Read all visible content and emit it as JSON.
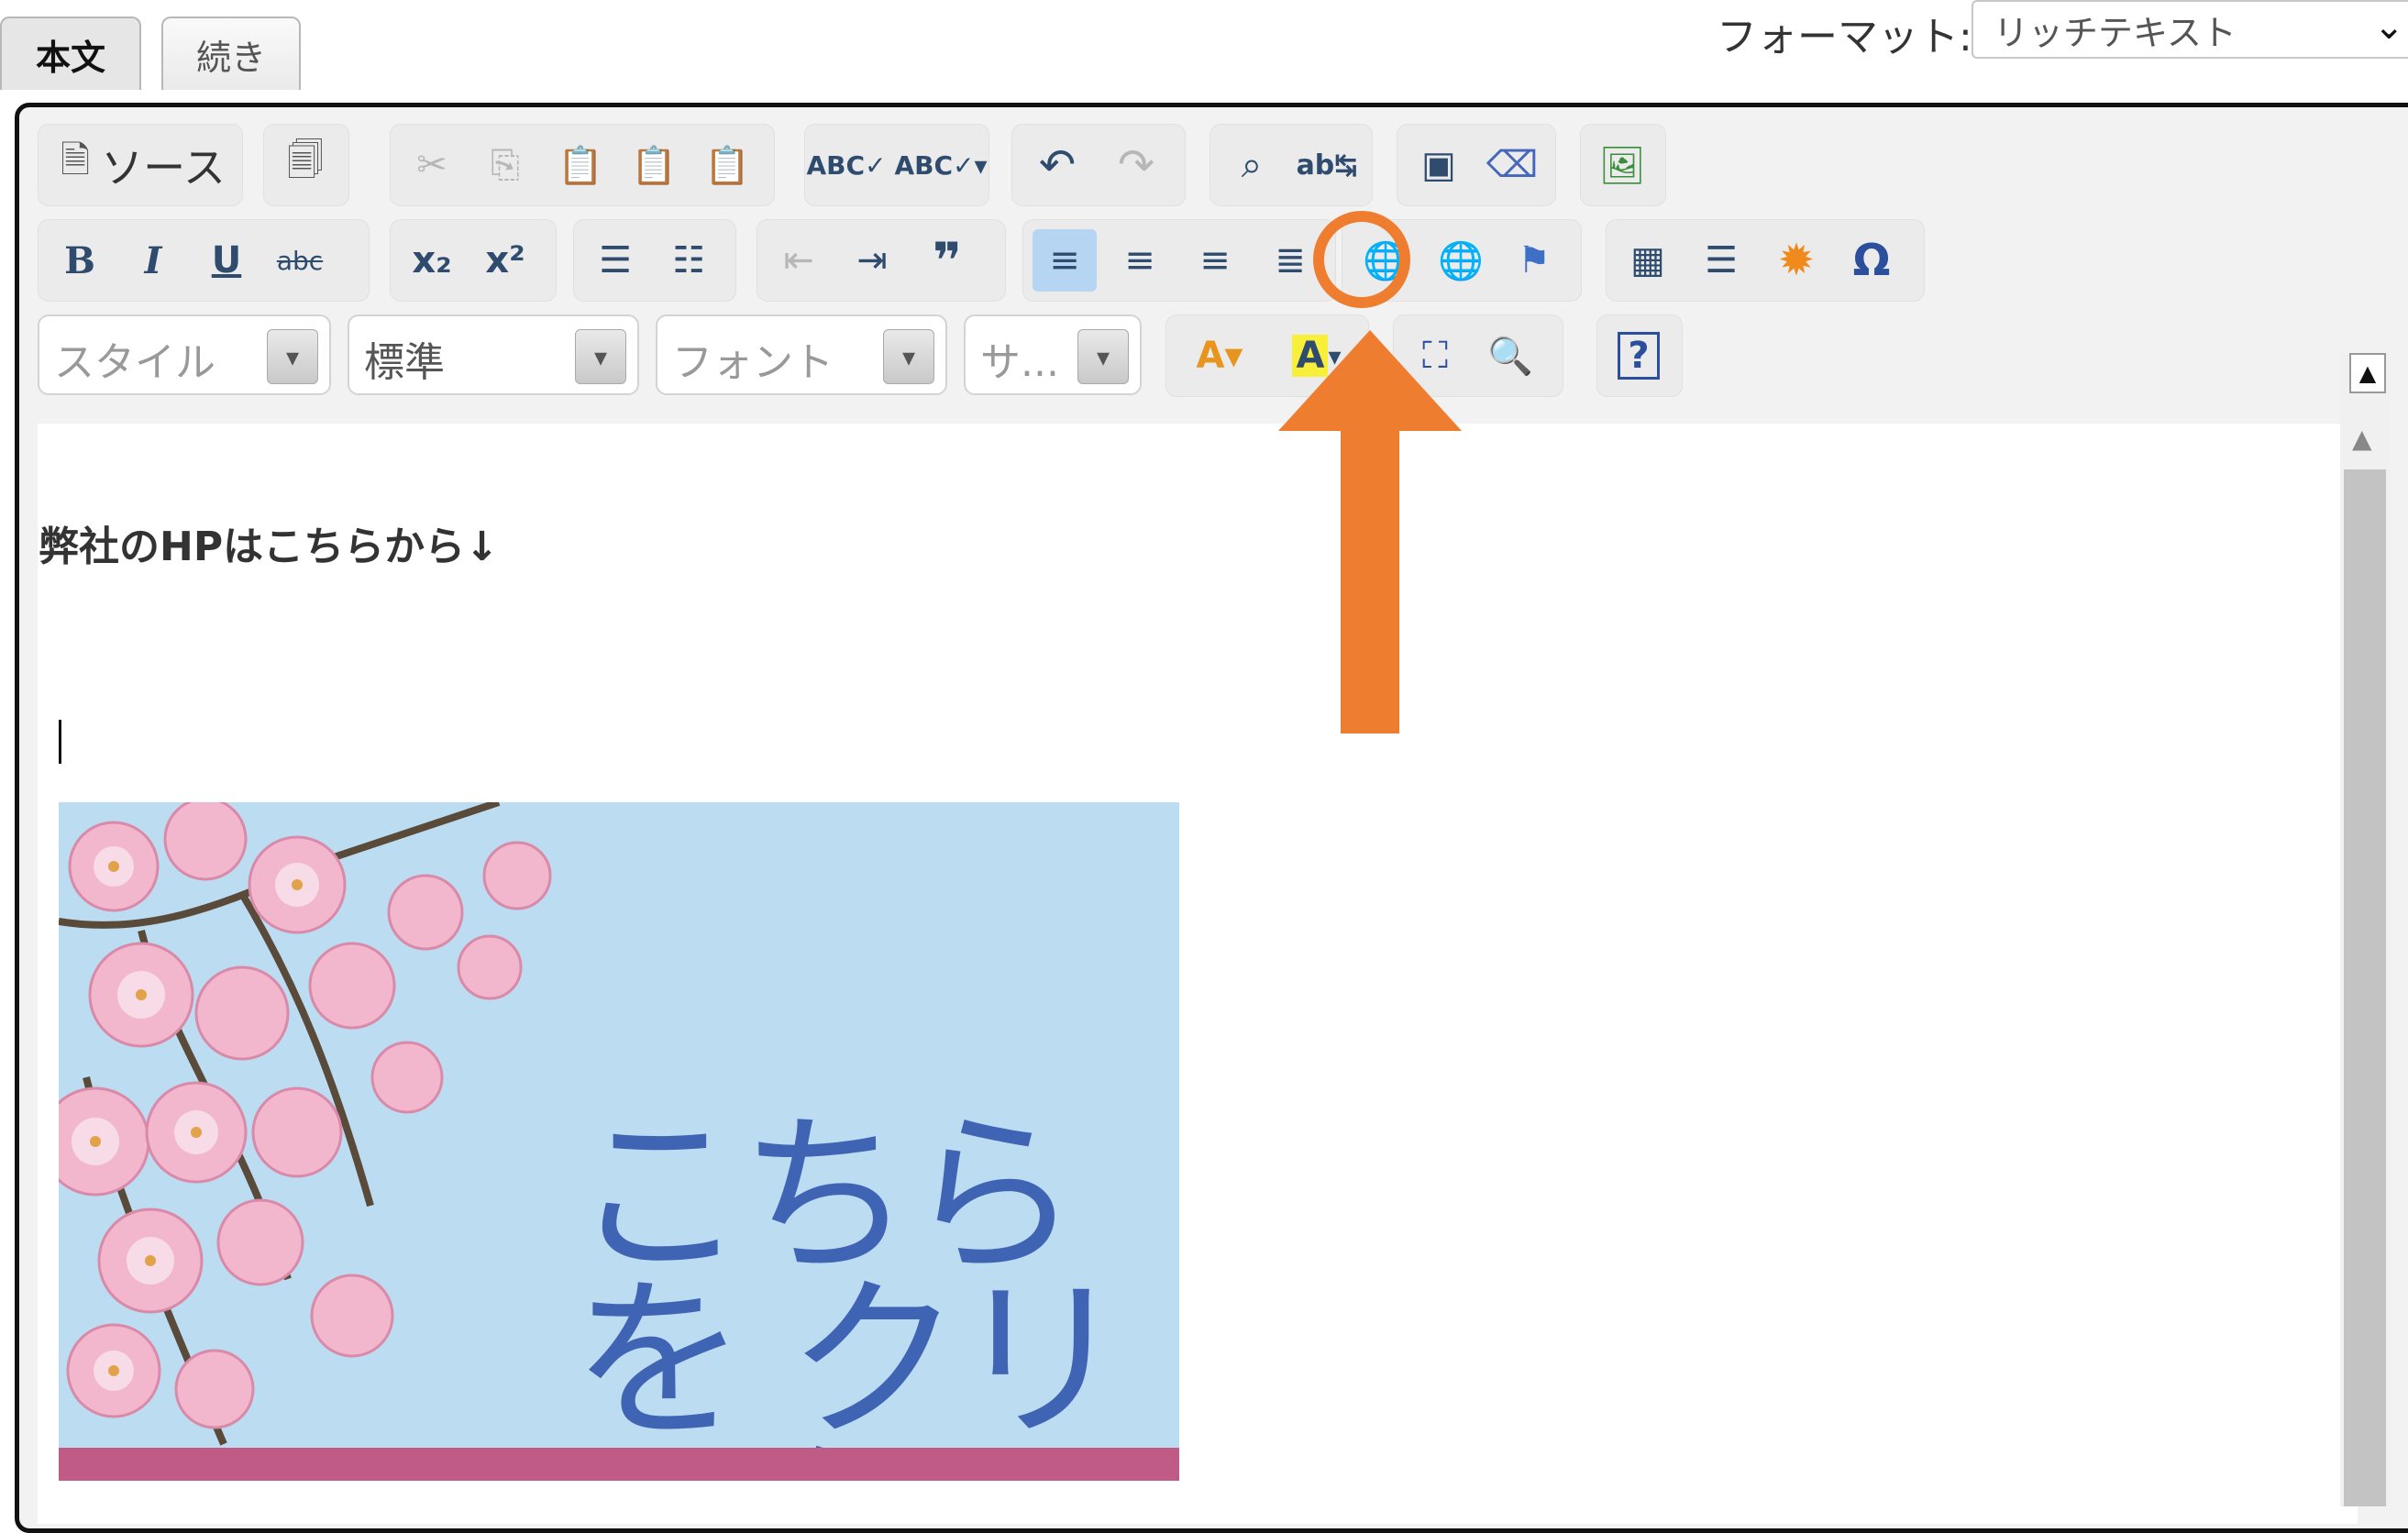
{
  "tabs": [
    {
      "label": "本文",
      "active": true
    },
    {
      "label": "続き",
      "active": false
    }
  ],
  "format": {
    "label": "フォーマット:",
    "value": "リッチテキスト"
  },
  "toolbar": {
    "source_label": "ソース",
    "row1_icons": [
      "source-icon",
      "template-icon",
      "cut-icon",
      "copy-icon",
      "paste-icon",
      "paste-text-icon",
      "paste-word-icon",
      "spellcheck-icon",
      "spellcheck-dropdown-icon",
      "undo-icon",
      "redo-icon",
      "find-icon",
      "replace-icon",
      "select-all-icon",
      "remove-format-icon",
      "image-icon"
    ],
    "row2": {
      "bold": "B",
      "italic": "I",
      "underline": "U",
      "strike": "abc",
      "subscript": "x₂",
      "superscript": "x²"
    },
    "combos": {
      "style": "スタイル",
      "format": "標準",
      "font": "フォント",
      "size": "サ..."
    }
  },
  "colors": {
    "accent": "#ee7d2f",
    "toolbar_active": "#b6d5f3",
    "banner_bg": "#bcdcf2",
    "banner_text": "#3f64b4",
    "banner_stripe": "#c05b86"
  },
  "content": {
    "heading": "弊社のHPはこちらから↓",
    "banner_text": "こちらを クリック"
  }
}
